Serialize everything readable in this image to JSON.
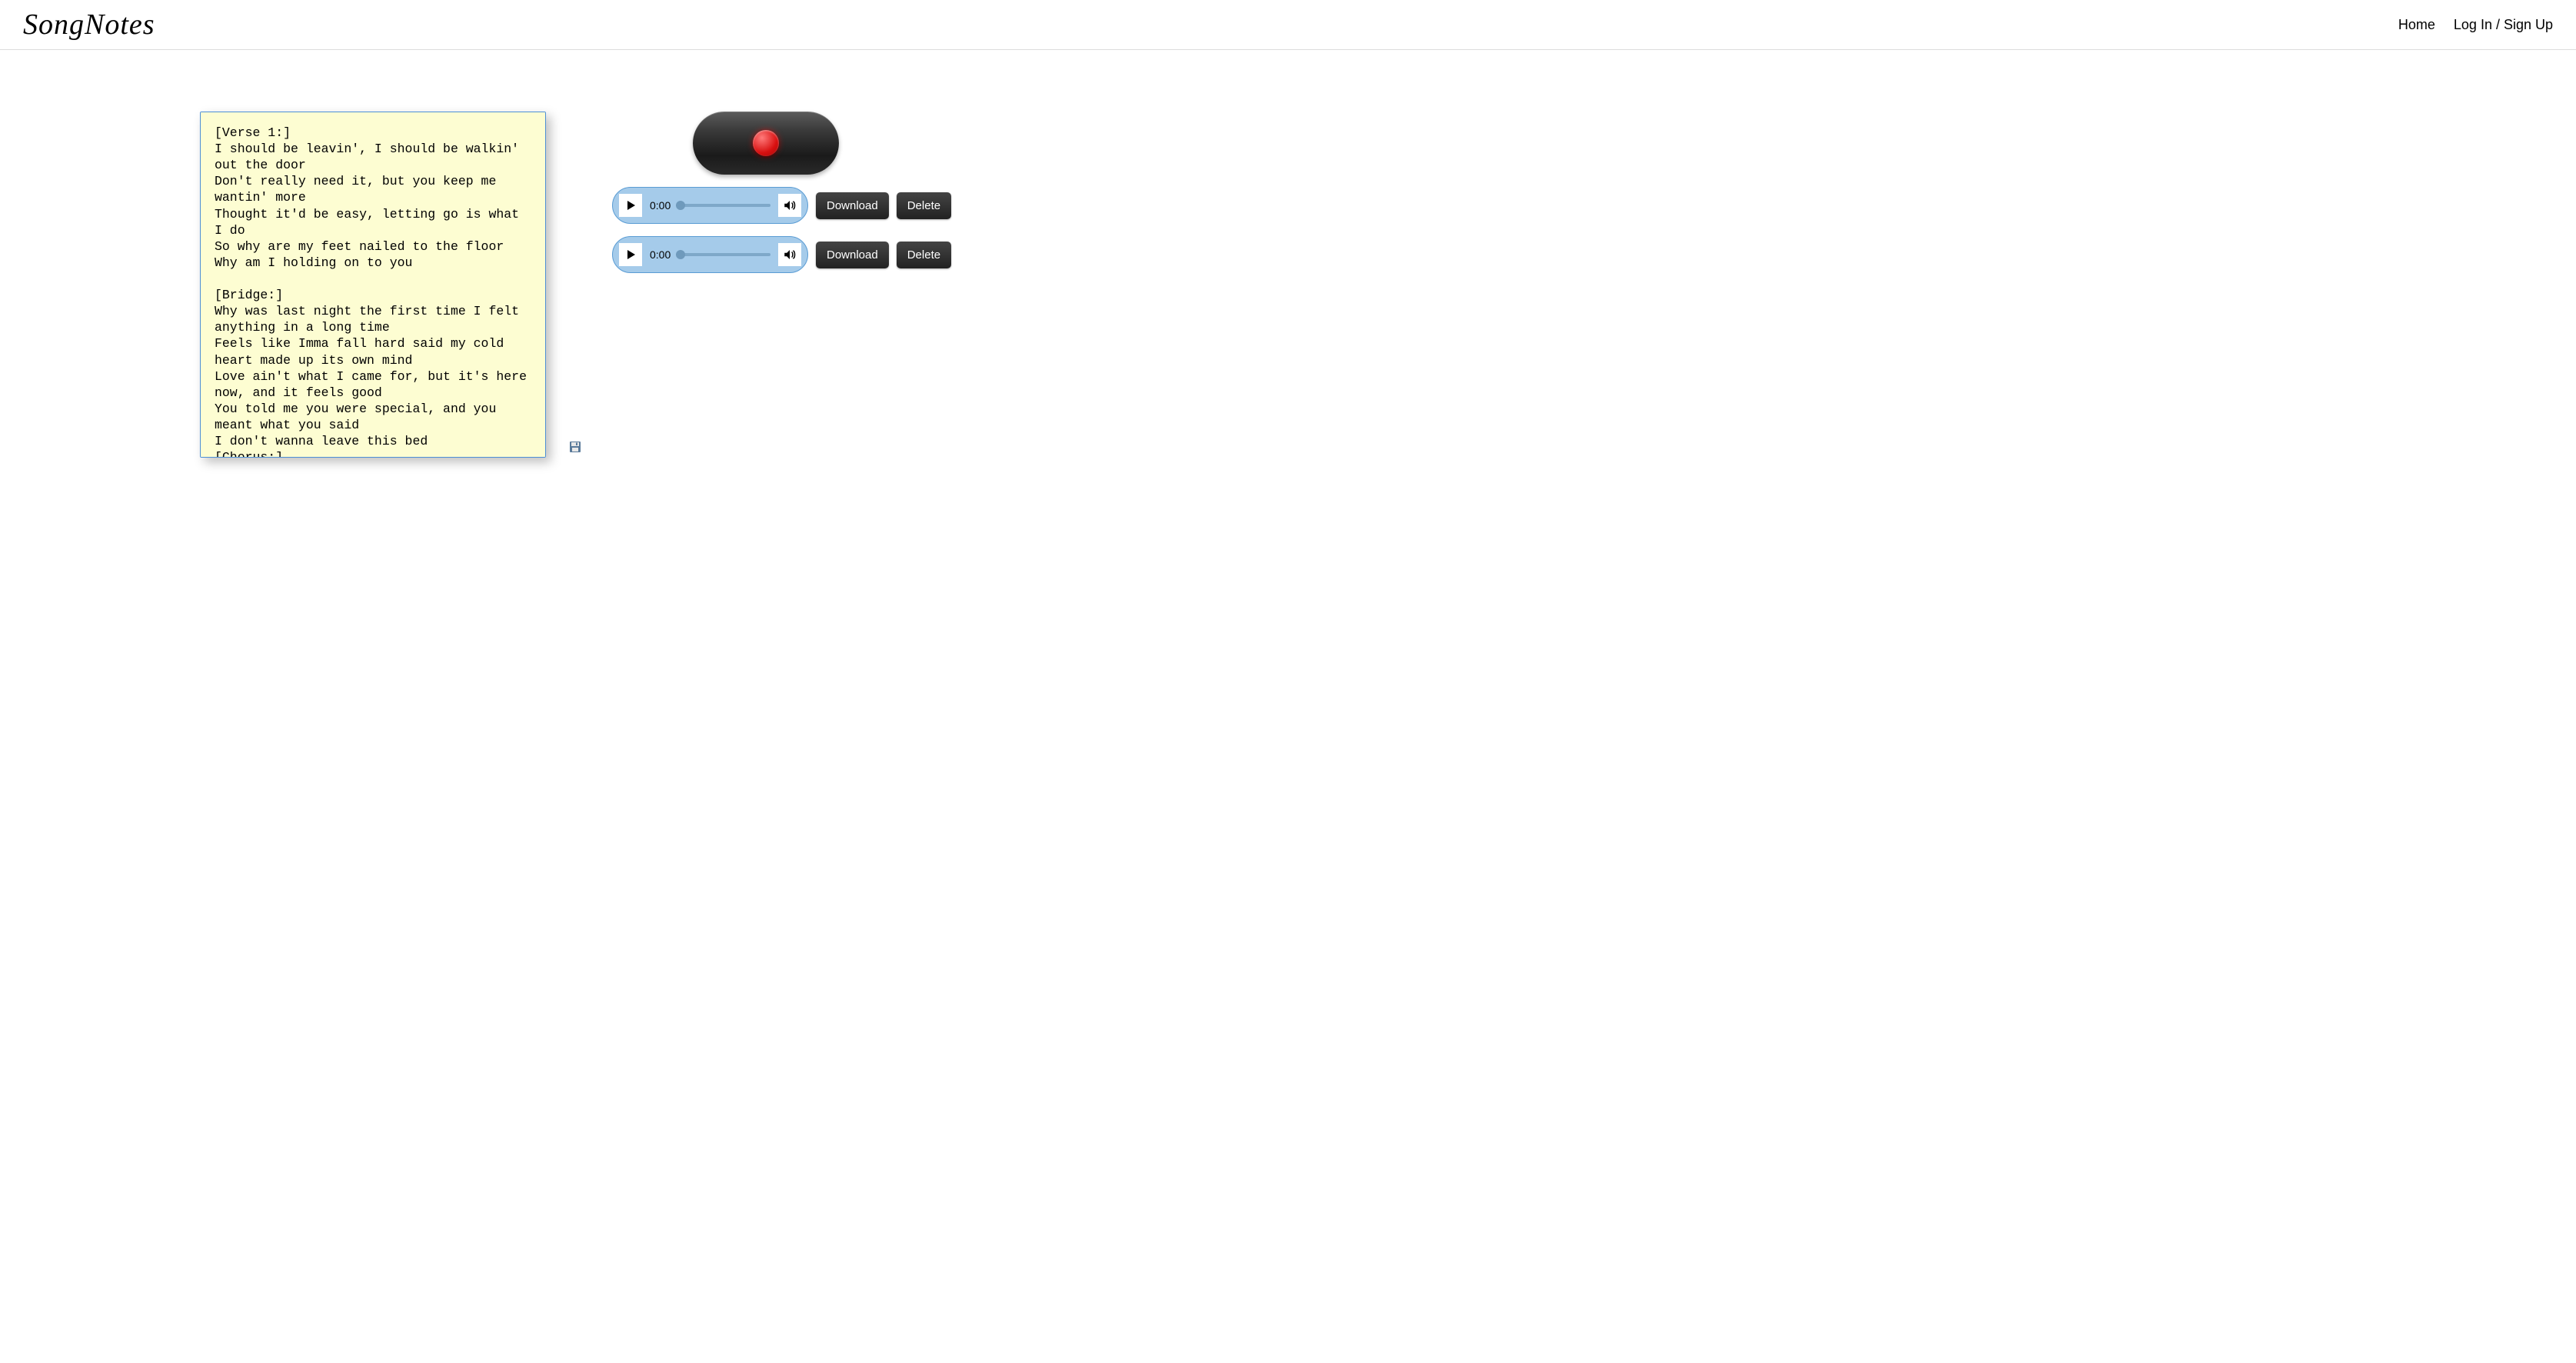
{
  "header": {
    "logo": "SongNotes",
    "nav": {
      "home": "Home",
      "login": "Log In / Sign Up"
    }
  },
  "lyrics": "[Verse 1:]\nI should be leavin', I should be walkin' out the door\nDon't really need it, but you keep me wantin' more\nThought it'd be easy, letting go is what I do\nSo why are my feet nailed to the floor\nWhy am I holding on to you\n\n[Bridge:]\nWhy was last night the first time I felt anything in a long time\nFeels like Imma fall hard said my cold heart made up its own mind\nLove ain't what I came for, but it's here now, and it feels good\nYou told me you were special, and you meant what you said\nI don't wanna leave this bed\n[Chorus:]",
  "audio_rows": [
    {
      "time": "0:00",
      "download_label": "Download",
      "delete_label": "Delete"
    },
    {
      "time": "0:00",
      "download_label": "Download",
      "delete_label": "Delete"
    }
  ]
}
